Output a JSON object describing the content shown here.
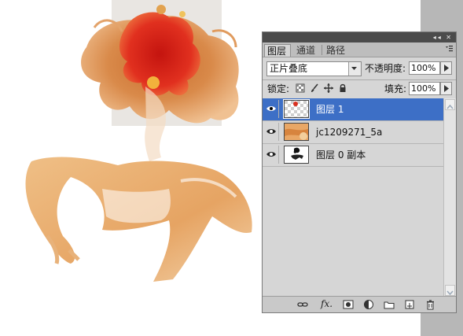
{
  "app": {
    "name": "Photoshop"
  },
  "panel": {
    "tabs": [
      {
        "label": "图层",
        "active": true
      },
      {
        "label": "通道",
        "active": false
      },
      {
        "label": "路径",
        "active": false
      }
    ],
    "titlebar_icons": [
      "collapse-icon",
      "close-icon"
    ],
    "blend_mode": "正片叠底",
    "opacity_label": "不透明度:",
    "opacity_value": "100%",
    "lock_label": "锁定:",
    "lock_icons": [
      "lock-transparent-icon",
      "lock-paint-icon",
      "lock-move-icon",
      "lock-all-icon"
    ],
    "fill_label": "填充:",
    "fill_value": "100%",
    "layers": [
      {
        "name": "图层 1",
        "selected": true,
        "visible": true
      },
      {
        "name": "jc1209271_5a",
        "selected": false,
        "visible": true
      },
      {
        "name": "图层 0 副本",
        "selected": false,
        "visible": true
      }
    ],
    "bottom_icons": [
      "link-layers-icon",
      "fx-icon",
      "add-mask-icon",
      "adjustment-layer-icon",
      "new-group-icon",
      "new-layer-icon",
      "delete-icon"
    ],
    "fx_label": "fx."
  },
  "colors": {
    "selected": "#3d6fc6",
    "panel_bg": "#d6d6d6",
    "accent_red": "#d82a1c",
    "accent_orange": "#e9913f"
  }
}
